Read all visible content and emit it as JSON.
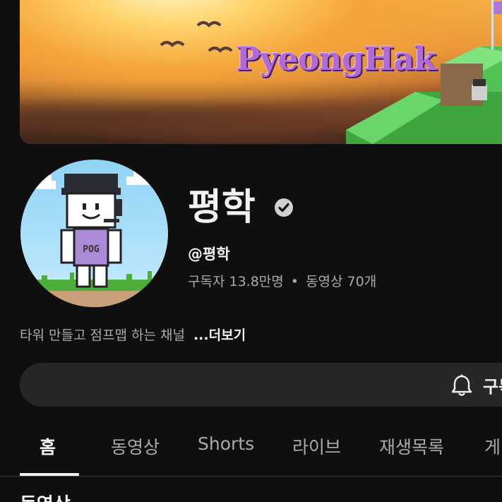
{
  "banner": {
    "title_art": "PyeongHak"
  },
  "channel": {
    "name": "평학",
    "handle": "@평학",
    "subscribers": "구독자 13.8만명",
    "separator": "•",
    "videos": "동영상 70개",
    "description": "타워 만들고 점프맵 하는 채널",
    "more_label": "...더보기"
  },
  "subscribe": {
    "label": "구독"
  },
  "tabs": [
    {
      "label": "홈",
      "active": true
    },
    {
      "label": "동영상"
    },
    {
      "label": "Shorts"
    },
    {
      "label": "라이브"
    },
    {
      "label": "재생목록"
    },
    {
      "label": "게"
    }
  ],
  "section": {
    "title": "동영상"
  },
  "colors": {
    "background": "#0f0f0f",
    "text_primary": "#f1f1f1",
    "text_secondary": "#aaaaaa",
    "button_bg": "#272727"
  },
  "icons": {
    "verified": "verified-check-icon",
    "bell": "bell-icon"
  }
}
